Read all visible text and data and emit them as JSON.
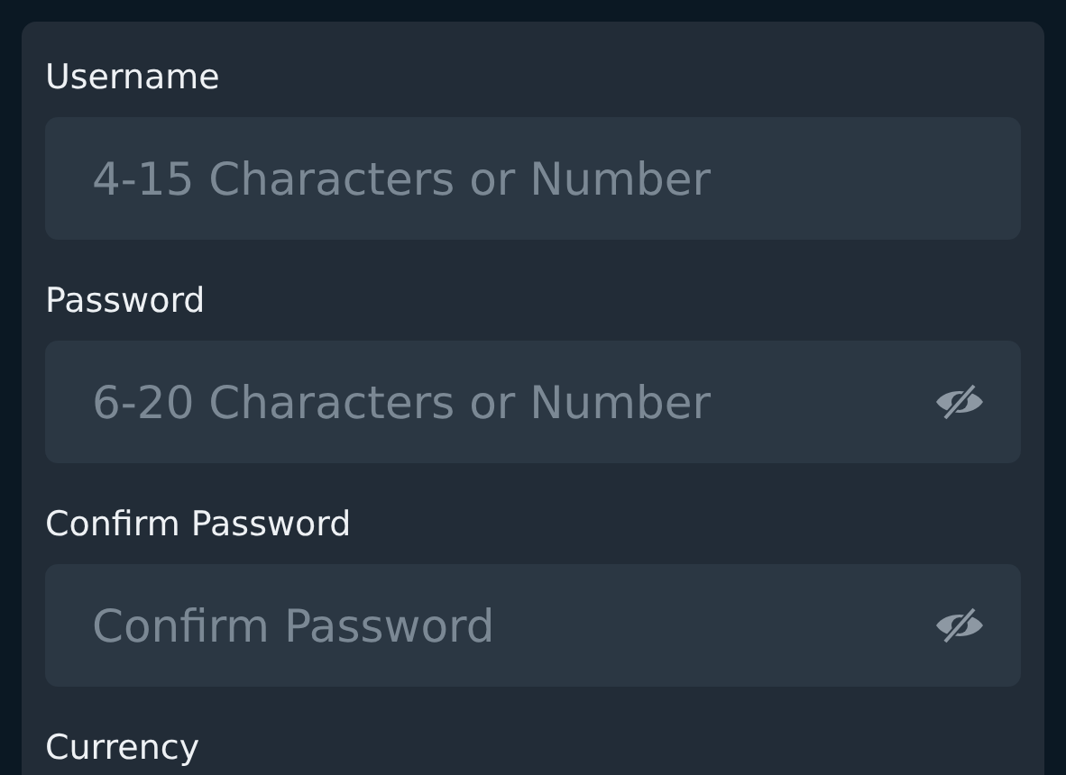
{
  "fields": [
    {
      "label": "Username",
      "placeholder": "4-15 Characters or Number",
      "kind": "text"
    },
    {
      "label": "Password",
      "placeholder": "6-20 Characters or Number",
      "kind": "password"
    },
    {
      "label": "Confirm Password",
      "placeholder": "Confirm Password",
      "kind": "password"
    }
  ],
  "next_label": "Currency"
}
